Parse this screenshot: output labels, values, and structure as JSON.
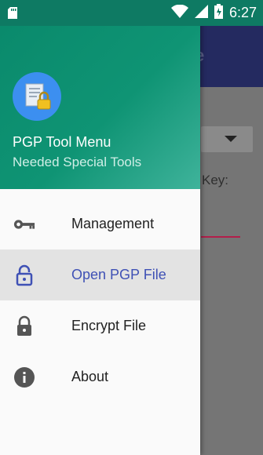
{
  "status_bar": {
    "time": "6:27"
  },
  "background_app": {
    "title_fragment": "e",
    "field_label_fragment": "Key:"
  },
  "drawer": {
    "header": {
      "title": "PGP Tool Menu",
      "subtitle": "Needed Special Tools"
    },
    "items": [
      {
        "label": "Management",
        "icon": "key-icon",
        "selected": false
      },
      {
        "label": "Open PGP File",
        "icon": "lock-open-icon",
        "selected": true
      },
      {
        "label": "Encrypt File",
        "icon": "lock-icon",
        "selected": false
      },
      {
        "label": "About",
        "icon": "info-icon",
        "selected": false
      }
    ]
  },
  "colors": {
    "header_green": "#0f9474",
    "selected_text": "#3f51b5",
    "toolbar_dim": "#242a60"
  }
}
